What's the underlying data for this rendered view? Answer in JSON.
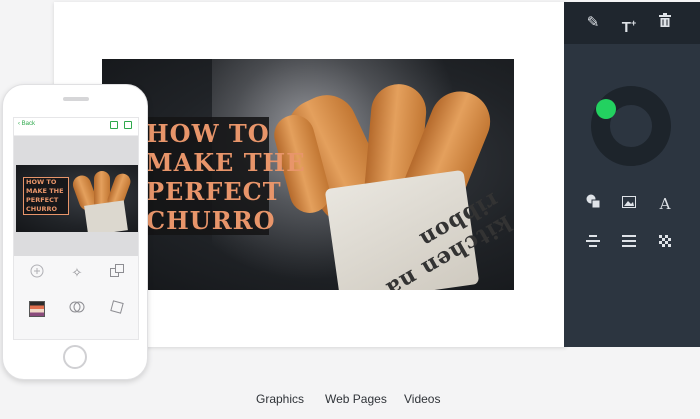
{
  "editor": {
    "hero_title_lines": [
      "HOW TO",
      "MAKE THE",
      "PERFECT",
      "CHURRO"
    ],
    "paper_text": "kitchen na ribbon"
  },
  "panel": {
    "top_icons": [
      "pencil-icon",
      "add-text-icon",
      "trash-icon"
    ],
    "tool_icons_row1": [
      "shapes-icon",
      "image-icon",
      "text-icon"
    ],
    "tool_icons_row2": [
      "align-center-icon",
      "align-justify-icon",
      "pattern-icon"
    ],
    "accent_color": "#23d160"
  },
  "phone": {
    "back_label": "Back",
    "hero_title_lines": [
      "HOW TO",
      "MAKE THE",
      "PERFECT",
      "CHURRO"
    ],
    "tool_icons": [
      "add-icon",
      "magic-wand-icon",
      "layers-icon",
      "palette-swatch-icon",
      "filter-icon",
      "resize-icon"
    ]
  },
  "tabs": [
    {
      "label": "Graphics"
    },
    {
      "label": "Web Pages"
    },
    {
      "label": "Videos"
    }
  ]
}
